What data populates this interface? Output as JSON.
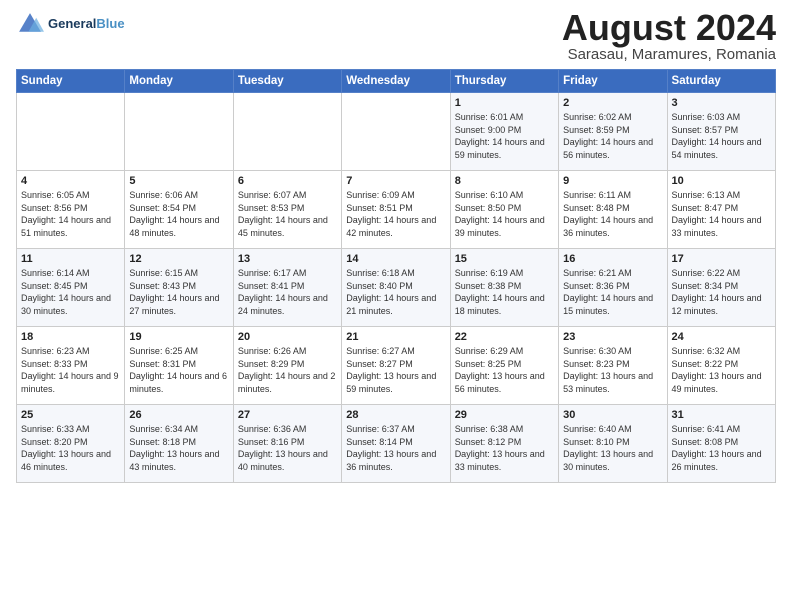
{
  "header": {
    "logo_line1": "General",
    "logo_line2": "Blue",
    "title": "August 2024",
    "subtitle": "Sarasau, Maramures, Romania"
  },
  "days_of_week": [
    "Sunday",
    "Monday",
    "Tuesday",
    "Wednesday",
    "Thursday",
    "Friday",
    "Saturday"
  ],
  "weeks": [
    [
      {
        "day": "",
        "text": ""
      },
      {
        "day": "",
        "text": ""
      },
      {
        "day": "",
        "text": ""
      },
      {
        "day": "",
        "text": ""
      },
      {
        "day": "1",
        "text": "Sunrise: 6:01 AM\nSunset: 9:00 PM\nDaylight: 14 hours and 59 minutes."
      },
      {
        "day": "2",
        "text": "Sunrise: 6:02 AM\nSunset: 8:59 PM\nDaylight: 14 hours and 56 minutes."
      },
      {
        "day": "3",
        "text": "Sunrise: 6:03 AM\nSunset: 8:57 PM\nDaylight: 14 hours and 54 minutes."
      }
    ],
    [
      {
        "day": "4",
        "text": "Sunrise: 6:05 AM\nSunset: 8:56 PM\nDaylight: 14 hours and 51 minutes."
      },
      {
        "day": "5",
        "text": "Sunrise: 6:06 AM\nSunset: 8:54 PM\nDaylight: 14 hours and 48 minutes."
      },
      {
        "day": "6",
        "text": "Sunrise: 6:07 AM\nSunset: 8:53 PM\nDaylight: 14 hours and 45 minutes."
      },
      {
        "day": "7",
        "text": "Sunrise: 6:09 AM\nSunset: 8:51 PM\nDaylight: 14 hours and 42 minutes."
      },
      {
        "day": "8",
        "text": "Sunrise: 6:10 AM\nSunset: 8:50 PM\nDaylight: 14 hours and 39 minutes."
      },
      {
        "day": "9",
        "text": "Sunrise: 6:11 AM\nSunset: 8:48 PM\nDaylight: 14 hours and 36 minutes."
      },
      {
        "day": "10",
        "text": "Sunrise: 6:13 AM\nSunset: 8:47 PM\nDaylight: 14 hours and 33 minutes."
      }
    ],
    [
      {
        "day": "11",
        "text": "Sunrise: 6:14 AM\nSunset: 8:45 PM\nDaylight: 14 hours and 30 minutes."
      },
      {
        "day": "12",
        "text": "Sunrise: 6:15 AM\nSunset: 8:43 PM\nDaylight: 14 hours and 27 minutes."
      },
      {
        "day": "13",
        "text": "Sunrise: 6:17 AM\nSunset: 8:41 PM\nDaylight: 14 hours and 24 minutes."
      },
      {
        "day": "14",
        "text": "Sunrise: 6:18 AM\nSunset: 8:40 PM\nDaylight: 14 hours and 21 minutes."
      },
      {
        "day": "15",
        "text": "Sunrise: 6:19 AM\nSunset: 8:38 PM\nDaylight: 14 hours and 18 minutes."
      },
      {
        "day": "16",
        "text": "Sunrise: 6:21 AM\nSunset: 8:36 PM\nDaylight: 14 hours and 15 minutes."
      },
      {
        "day": "17",
        "text": "Sunrise: 6:22 AM\nSunset: 8:34 PM\nDaylight: 14 hours and 12 minutes."
      }
    ],
    [
      {
        "day": "18",
        "text": "Sunrise: 6:23 AM\nSunset: 8:33 PM\nDaylight: 14 hours and 9 minutes."
      },
      {
        "day": "19",
        "text": "Sunrise: 6:25 AM\nSunset: 8:31 PM\nDaylight: 14 hours and 6 minutes."
      },
      {
        "day": "20",
        "text": "Sunrise: 6:26 AM\nSunset: 8:29 PM\nDaylight: 14 hours and 2 minutes."
      },
      {
        "day": "21",
        "text": "Sunrise: 6:27 AM\nSunset: 8:27 PM\nDaylight: 13 hours and 59 minutes."
      },
      {
        "day": "22",
        "text": "Sunrise: 6:29 AM\nSunset: 8:25 PM\nDaylight: 13 hours and 56 minutes."
      },
      {
        "day": "23",
        "text": "Sunrise: 6:30 AM\nSunset: 8:23 PM\nDaylight: 13 hours and 53 minutes."
      },
      {
        "day": "24",
        "text": "Sunrise: 6:32 AM\nSunset: 8:22 PM\nDaylight: 13 hours and 49 minutes."
      }
    ],
    [
      {
        "day": "25",
        "text": "Sunrise: 6:33 AM\nSunset: 8:20 PM\nDaylight: 13 hours and 46 minutes."
      },
      {
        "day": "26",
        "text": "Sunrise: 6:34 AM\nSunset: 8:18 PM\nDaylight: 13 hours and 43 minutes."
      },
      {
        "day": "27",
        "text": "Sunrise: 6:36 AM\nSunset: 8:16 PM\nDaylight: 13 hours and 40 minutes."
      },
      {
        "day": "28",
        "text": "Sunrise: 6:37 AM\nSunset: 8:14 PM\nDaylight: 13 hours and 36 minutes."
      },
      {
        "day": "29",
        "text": "Sunrise: 6:38 AM\nSunset: 8:12 PM\nDaylight: 13 hours and 33 minutes."
      },
      {
        "day": "30",
        "text": "Sunrise: 6:40 AM\nSunset: 8:10 PM\nDaylight: 13 hours and 30 minutes."
      },
      {
        "day": "31",
        "text": "Sunrise: 6:41 AM\nSunset: 8:08 PM\nDaylight: 13 hours and 26 minutes."
      }
    ]
  ]
}
